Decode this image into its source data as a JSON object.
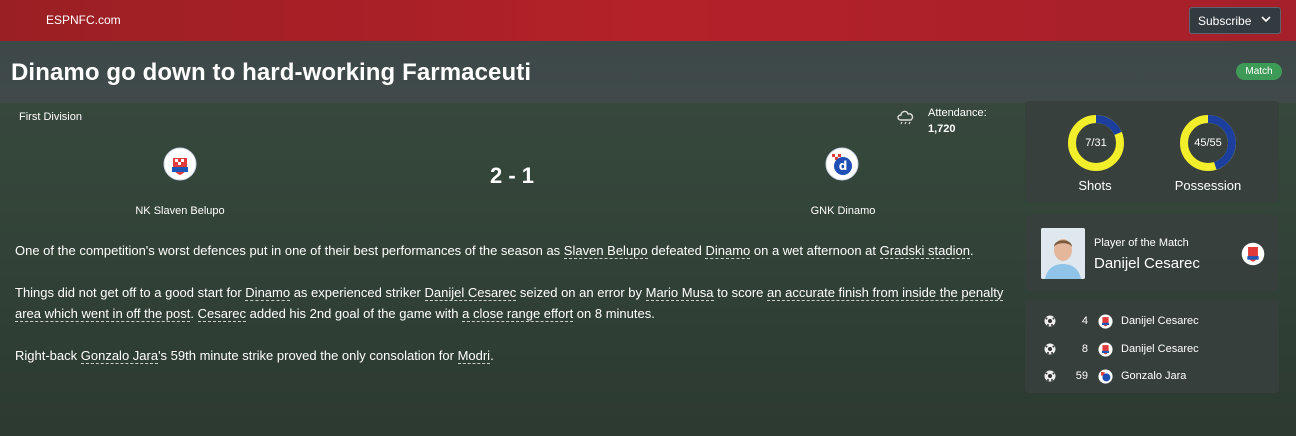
{
  "header": {
    "brand": "ESPNFC.com",
    "subscribe_label": "Subscribe"
  },
  "article": {
    "headline": "Dinamo go down to hard-working Farmaceuti",
    "badge": "Match"
  },
  "match": {
    "competition": "First Division",
    "attendance_label": "Attendance:",
    "attendance_value": "1,720",
    "weather_icon": "rain-cloud-icon",
    "score": "2 - 1",
    "home_team": "NK Slaven Belupo",
    "away_team": "GNK Dinamo"
  },
  "report": {
    "p1": {
      "t1": "One of the competition's worst defences put in one of their best performances of the season as ",
      "l1": "Slaven Belupo",
      "t2": " defeated ",
      "l2": "Dinamo",
      "t3": " on a wet afternoon at ",
      "l3": "Gradski stadion",
      "t4": "."
    },
    "p2": {
      "t1": "Things did not get off to a good start for ",
      "l1": "Dinamo",
      "t2": " as experienced striker ",
      "l2": "Danijel Cesarec",
      "t3": " seized on an error by ",
      "l3": "Mario Musa",
      "t4": " to score ",
      "l4": "an accurate finish from inside the penalty area which went in off the post",
      "t5": ". ",
      "l5": "Cesarec",
      "t6": " added his 2nd goal of the game with ",
      "l6": "a close range effort",
      "t7": " on 8 minutes."
    },
    "p3": {
      "t1": "Right-back ",
      "l1": "Gonzalo Jara",
      "t2": "'s 59th minute strike proved the only consolation for ",
      "l2": "Modri",
      "t3": "."
    }
  },
  "stats": {
    "shots_value": "7/31",
    "shots_label": "Shots",
    "shots_home": 7,
    "shots_away": 31,
    "possession_value": "45/55",
    "possession_label": "Possession",
    "possession_home": 45,
    "possession_away": 55,
    "home_color": "#1c3f9e",
    "away_color": "#f2ee2a"
  },
  "potm": {
    "title": "Player of the Match",
    "name": "Danijel Cesarec"
  },
  "goals": [
    {
      "minute": "4",
      "scorer": "Danijel Cesarec",
      "team": "home"
    },
    {
      "minute": "8",
      "scorer": "Danijel Cesarec",
      "team": "home"
    },
    {
      "minute": "59",
      "scorer": "Gonzalo Jara",
      "team": "away"
    }
  ]
}
